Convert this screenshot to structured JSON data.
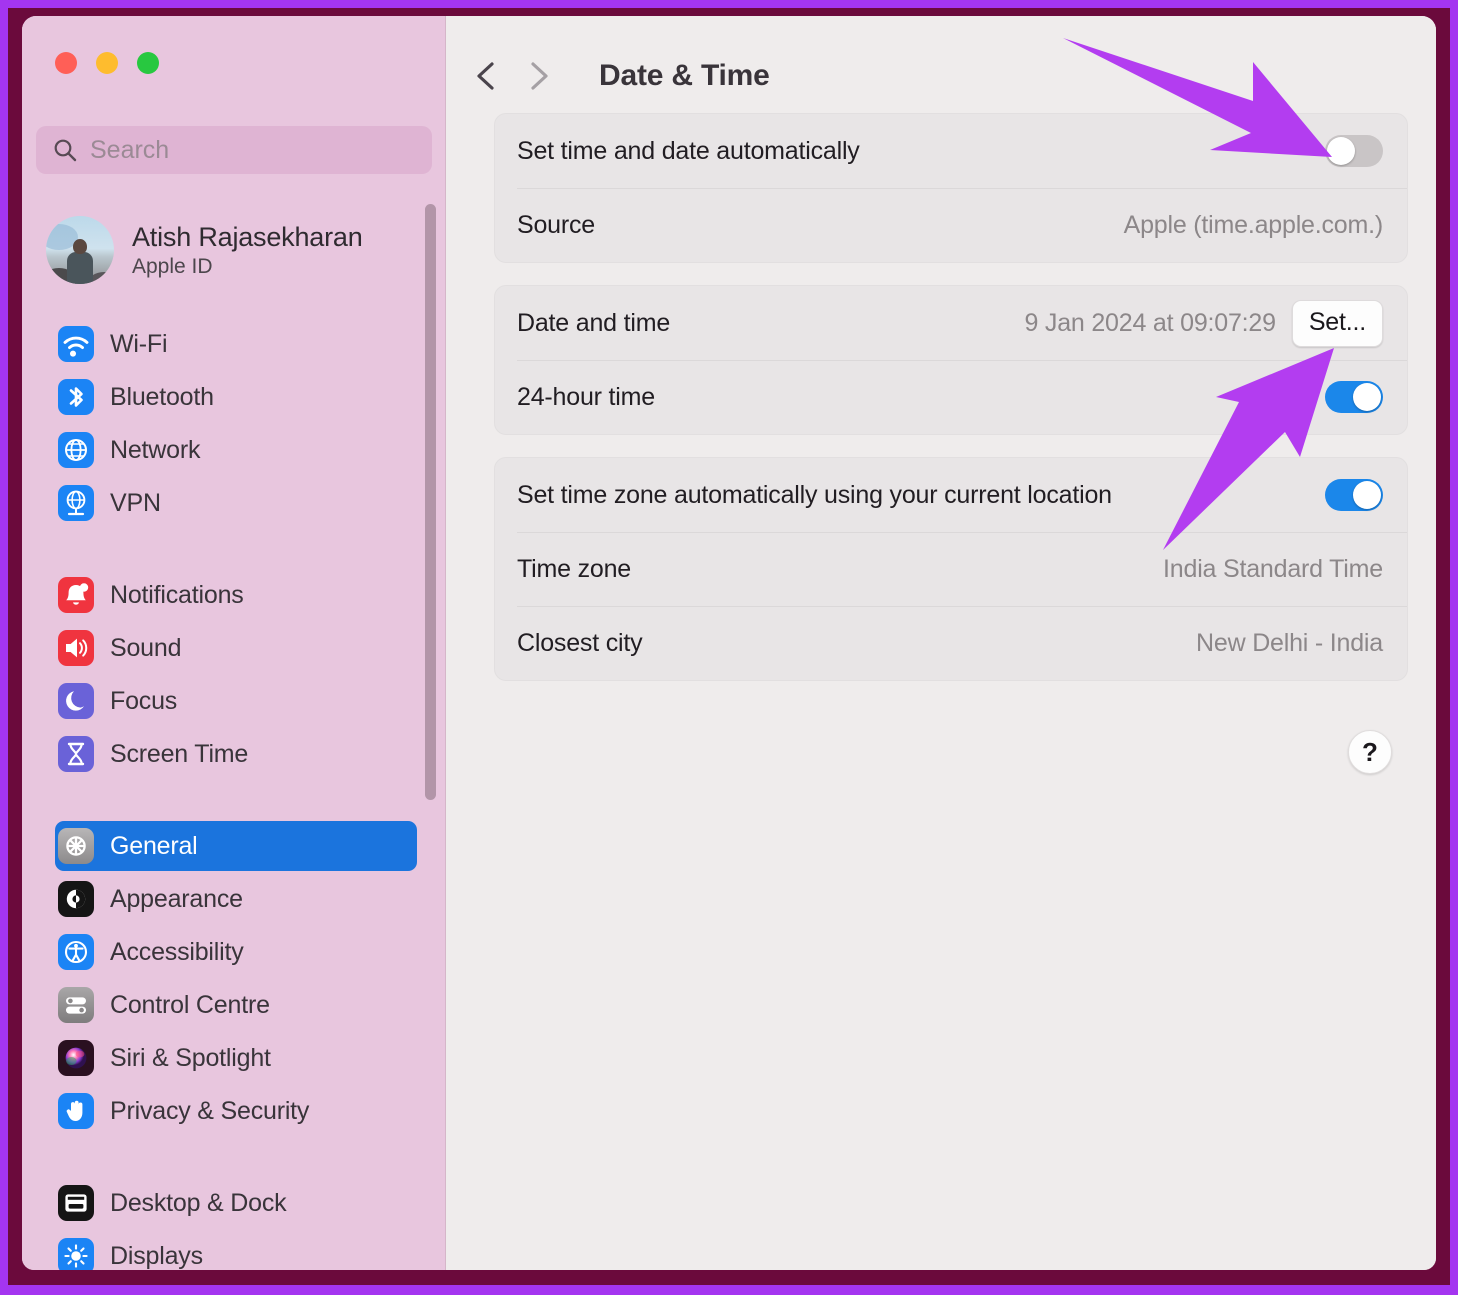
{
  "window": {
    "traffic_lights": [
      {
        "name": "close",
        "color": "#ff5f57"
      },
      {
        "name": "minimize",
        "color": "#febc2e"
      },
      {
        "name": "zoom",
        "color": "#28c840"
      }
    ]
  },
  "sidebar": {
    "search": {
      "placeholder": "Search",
      "value": "",
      "icon": "search-icon"
    },
    "account": {
      "name": "Atish Rajasekharan",
      "subtitle": "Apple ID",
      "avatar": "user-avatar"
    },
    "groups": [
      {
        "items": [
          {
            "label": "Wi-Fi",
            "icon": "wifi-icon",
            "active": false
          },
          {
            "label": "Bluetooth",
            "icon": "bluetooth-icon",
            "active": false
          },
          {
            "label": "Network",
            "icon": "network-globe-icon",
            "active": false
          },
          {
            "label": "VPN",
            "icon": "vpn-globe-icon",
            "active": false
          }
        ]
      },
      {
        "items": [
          {
            "label": "Notifications",
            "icon": "bell-icon",
            "active": false
          },
          {
            "label": "Sound",
            "icon": "speaker-icon",
            "active": false
          },
          {
            "label": "Focus",
            "icon": "moon-icon",
            "active": false
          },
          {
            "label": "Screen Time",
            "icon": "hourglass-icon",
            "active": false
          }
        ]
      },
      {
        "items": [
          {
            "label": "General",
            "icon": "gear-icon",
            "active": true
          },
          {
            "label": "Appearance",
            "icon": "appearance-icon",
            "active": false
          },
          {
            "label": "Accessibility",
            "icon": "accessibility-icon",
            "active": false
          },
          {
            "label": "Control Centre",
            "icon": "control-centre-icon",
            "active": false
          },
          {
            "label": "Siri & Spotlight",
            "icon": "siri-icon",
            "active": false
          },
          {
            "label": "Privacy & Security",
            "icon": "hand-icon",
            "active": false
          }
        ]
      },
      {
        "items": [
          {
            "label": "Desktop & Dock",
            "icon": "desktop-dock-icon",
            "active": false
          },
          {
            "label": "Displays",
            "icon": "brightness-icon",
            "active": false
          }
        ]
      }
    ]
  },
  "main": {
    "back_icon": "chevron-left-icon",
    "forward_icon": "chevron-right-icon",
    "title": "Date & Time",
    "help_label": "?",
    "cards": [
      {
        "rows": [
          {
            "label": "Set time and date automatically",
            "control": "toggle",
            "state": "off"
          },
          {
            "label": "Source",
            "value": "Apple (time.apple.com.)",
            "control": "text"
          }
        ]
      },
      {
        "rows": [
          {
            "label": "Date and time",
            "value": "9 Jan 2024 at 09:07:29",
            "control": "button",
            "button_label": "Set..."
          },
          {
            "label": "24-hour time",
            "control": "toggle",
            "state": "on"
          }
        ]
      },
      {
        "rows": [
          {
            "label": "Set time zone automatically using your current location",
            "control": "toggle",
            "state": "on"
          },
          {
            "label": "Time zone",
            "value": "India Standard Time",
            "control": "text"
          },
          {
            "label": "Closest city",
            "value": "New Delhi - India",
            "control": "text"
          }
        ]
      }
    ]
  },
  "annotations": {
    "arrow_color": "#b33df0",
    "arrows": [
      {
        "name": "arrow-to-auto-toggle",
        "target": "Set time and date automatically toggle"
      },
      {
        "name": "arrow-to-set-button",
        "target": "Set... button"
      }
    ]
  },
  "colors": {
    "frame_outer": "#a435f0",
    "frame_inner": "#6b0a3c",
    "sidebar_bg": "#e8c6de",
    "main_bg": "#efecec",
    "card_bg": "#e8e5e6",
    "accent_blue": "#1b74dd",
    "toggle_on": "#1b87ea",
    "annotation_purple": "#b33df0"
  }
}
